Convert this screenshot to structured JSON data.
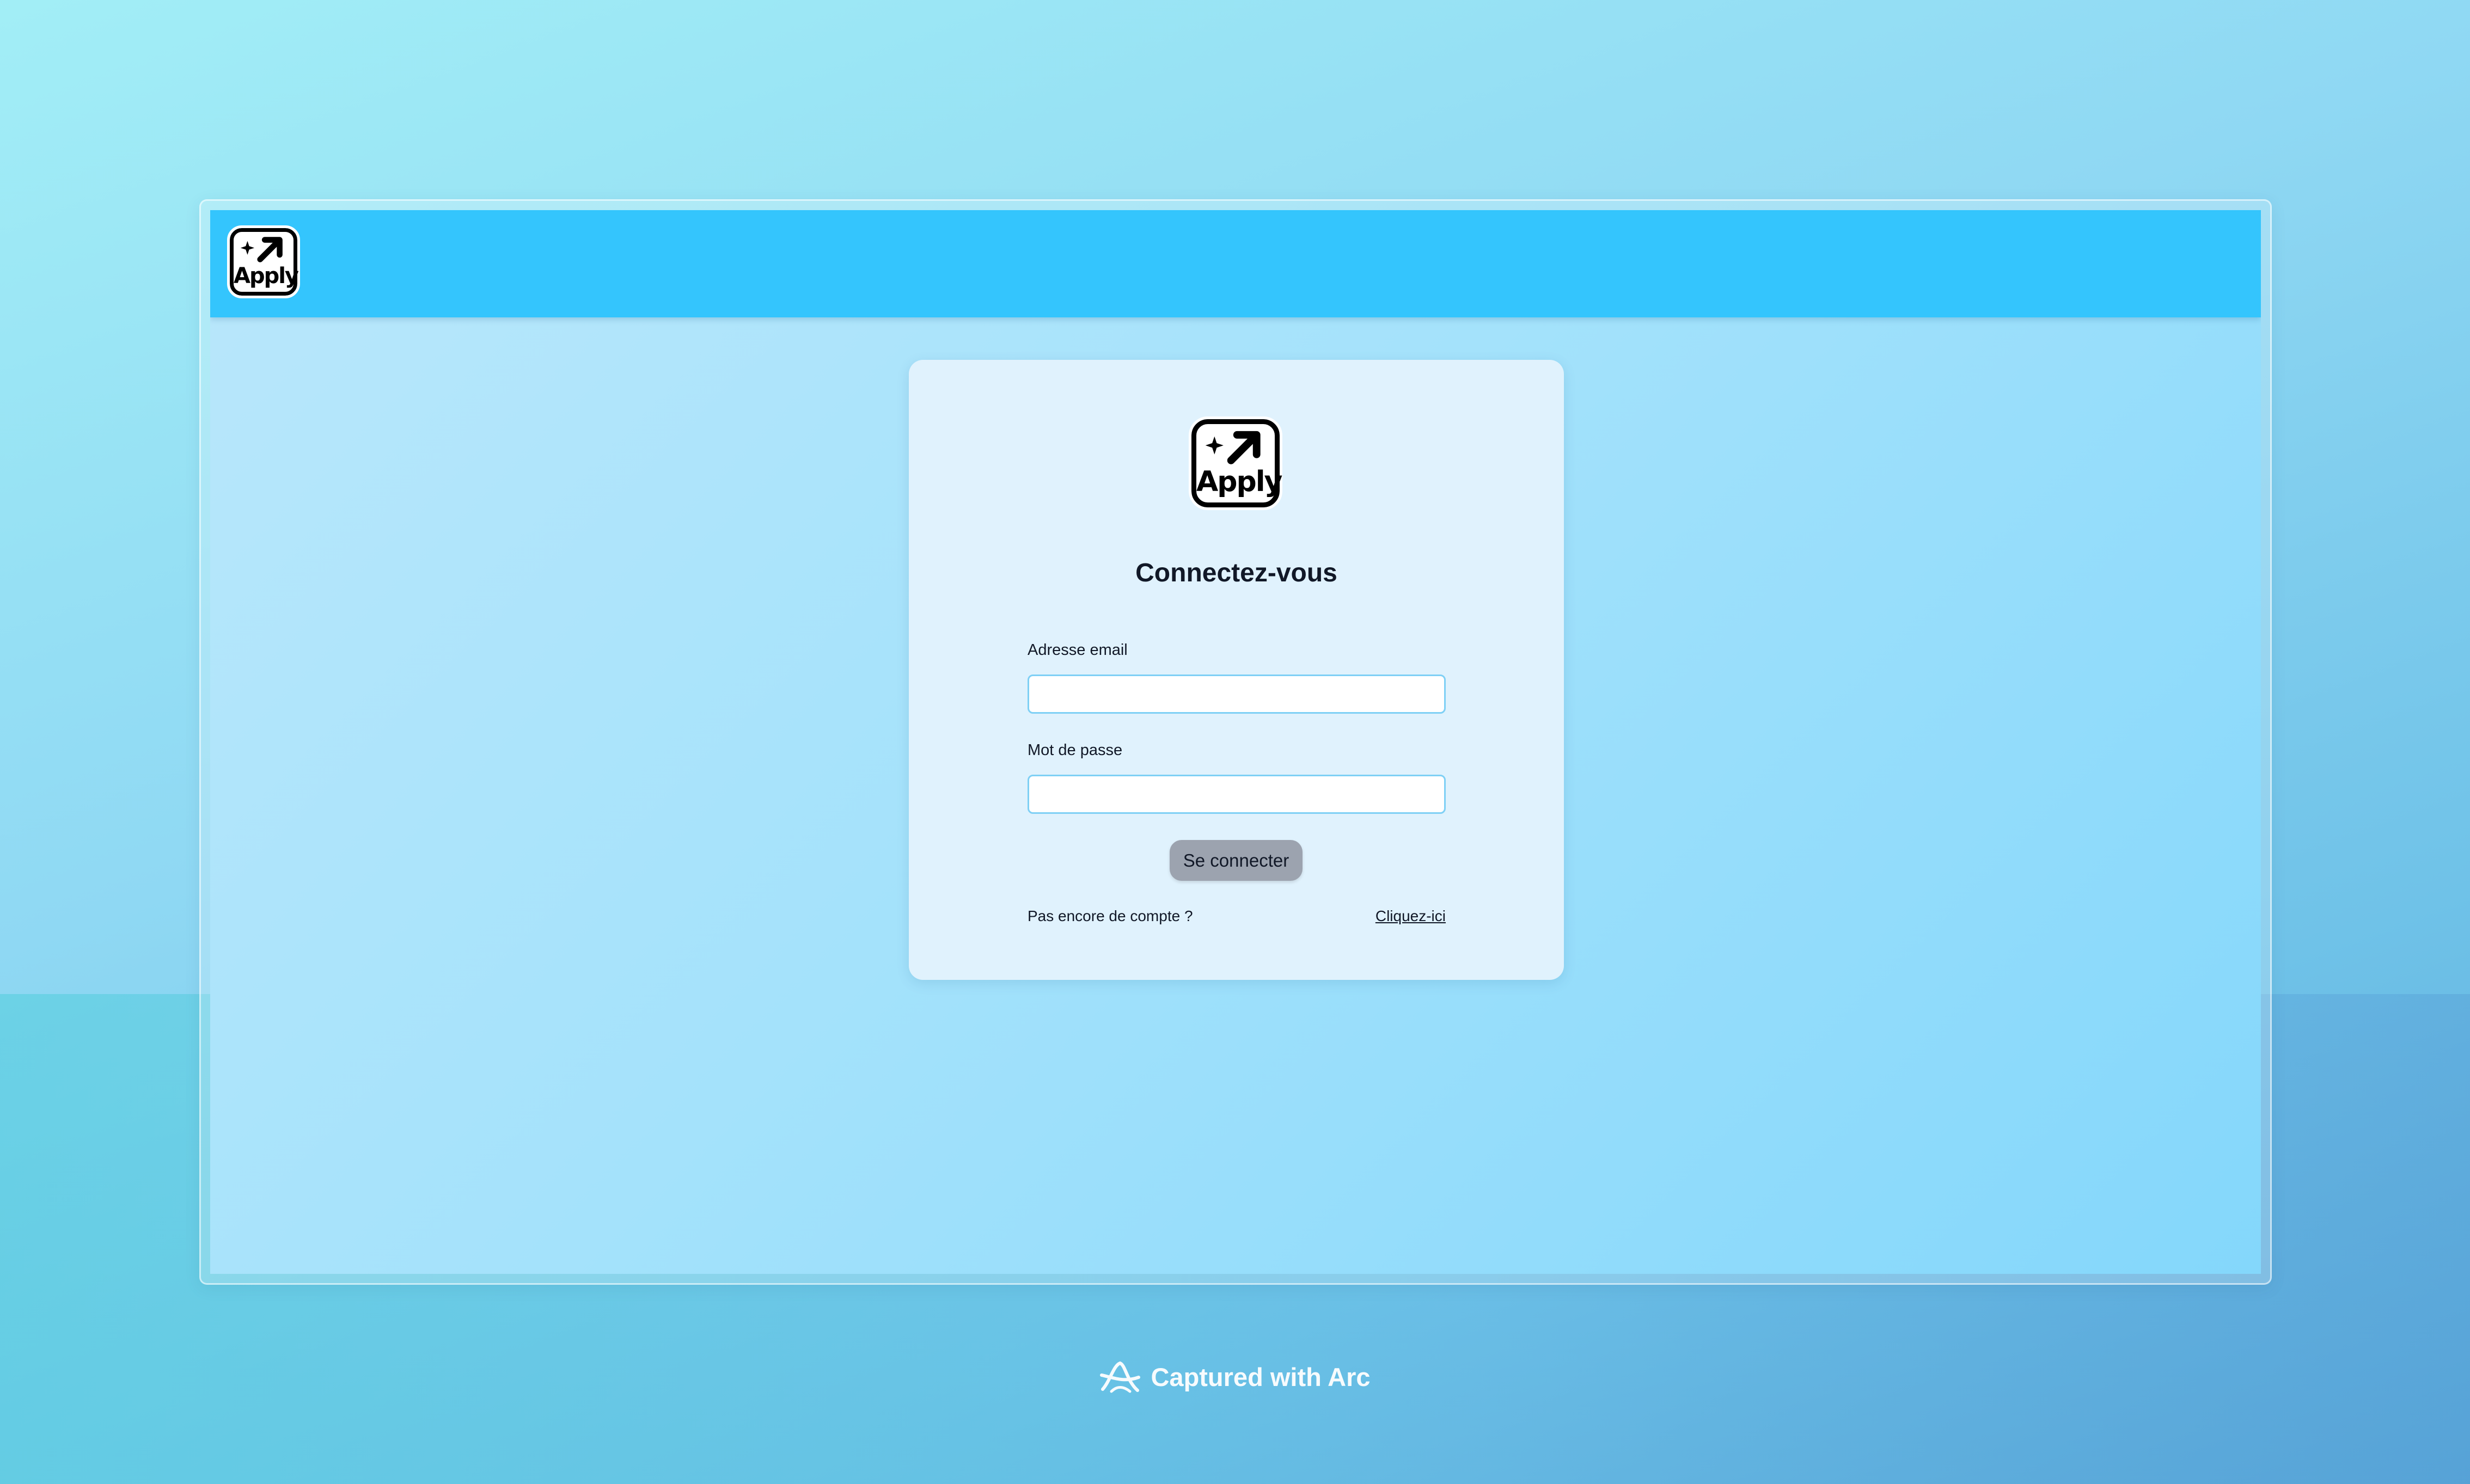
{
  "navbar": {
    "logo_text": "Apply",
    "background": "#34c5fd"
  },
  "login": {
    "logo_text": "Apply",
    "title": "Connectez-vous",
    "email_label": "Adresse email",
    "email_value": "",
    "password_label": "Mot de passe",
    "password_value": "",
    "submit_label": "Se connecter",
    "signup_prompt": "Pas encore de compte ?",
    "signup_link": "Cliquez-ici"
  },
  "watermark": {
    "text": "Captured with Arc",
    "icon": "arc-logo-icon"
  },
  "colors": {
    "accent": "#34c5fd",
    "button": "#9ca3af",
    "card": "#e0f2fd",
    "input_border": "#7fd0f5"
  }
}
